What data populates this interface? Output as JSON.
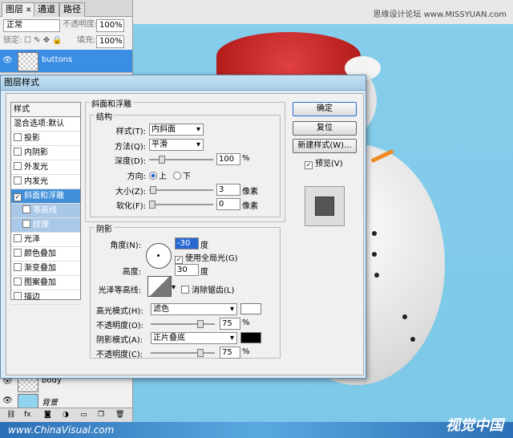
{
  "watermark": {
    "credit": "思缘设计论坛 www.MISSYUAN.com",
    "url": "www.ChinaVisual.com",
    "logo": "视觉中国"
  },
  "layers_panel": {
    "tabs": [
      "图层",
      "通道",
      "路径"
    ],
    "blend_mode": "正常",
    "opacity_label": "不透明度:",
    "opacity_value": "100%",
    "lock_label": "锁定:",
    "fill_label": "填充:",
    "fill_value": "100%",
    "layers": [
      {
        "name": "buttons"
      },
      {
        "name": "body"
      },
      {
        "name": "背景"
      }
    ]
  },
  "dialog": {
    "title": "图层样式",
    "styles_header": "样式",
    "styles": [
      {
        "label": "混合选项:默认"
      },
      {
        "label": "投影"
      },
      {
        "label": "内阴影"
      },
      {
        "label": "外发光"
      },
      {
        "label": "内发光"
      },
      {
        "label": "斜面和浮雕"
      },
      {
        "label": "等高线"
      },
      {
        "label": "纹理"
      },
      {
        "label": "光泽"
      },
      {
        "label": "颜色叠加"
      },
      {
        "label": "渐变叠加"
      },
      {
        "label": "图案叠加"
      },
      {
        "label": "描边"
      }
    ],
    "bevel": {
      "section_title": "斜面和浮雕",
      "structure_title": "结构",
      "style_label": "样式(T):",
      "style_value": "内斜面",
      "technique_label": "方法(Q):",
      "technique_value": "平滑",
      "depth_label": "深度(D):",
      "depth_value": "100",
      "depth_unit": "%",
      "direction_label": "方向:",
      "up_label": "上",
      "down_label": "下",
      "size_label": "大小(Z):",
      "size_value": "3",
      "size_unit": "像素",
      "soften_label": "软化(F):",
      "soften_value": "0",
      "soften_unit": "像素"
    },
    "shading": {
      "title": "阴影",
      "angle_label": "角度(N):",
      "angle_value": "-30",
      "angle_unit": "度",
      "global_light_label": "使用全局光(G)",
      "altitude_label": "高度:",
      "altitude_value": "30",
      "altitude_unit": "度",
      "contour_label": "光泽等高线:",
      "antialias_label": "消除锯齿(L)",
      "highlight_mode_label": "高光模式(H):",
      "highlight_mode_value": "滤色",
      "highlight_opacity_label": "不透明度(O):",
      "highlight_opacity_value": "75",
      "shadow_mode_label": "阴影模式(A):",
      "shadow_mode_value": "正片叠底",
      "shadow_opacity_label": "不透明度(C):",
      "shadow_opacity_value": "75",
      "percent": "%",
      "highlight_color": "#ffffff",
      "shadow_color": "#000000"
    },
    "buttons": {
      "ok": "确定",
      "reset": "复位",
      "new_style": "新建样式(W)...",
      "preview": "预览(V)"
    }
  }
}
